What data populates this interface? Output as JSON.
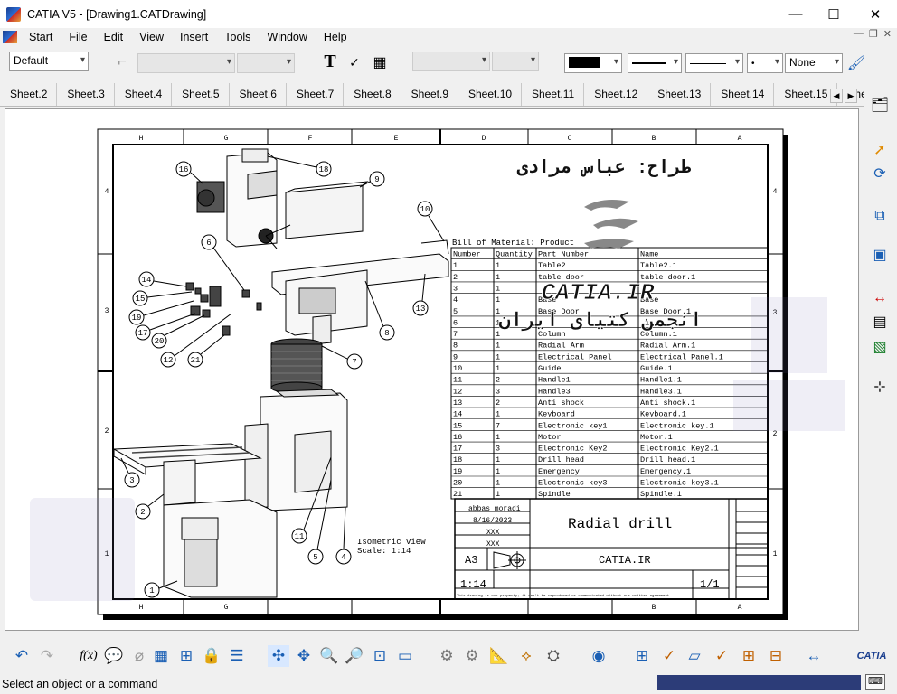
{
  "window": {
    "title": "CATIA V5 - [Drawing1.CATDrawing]",
    "min_glyph": "—",
    "max_glyph": "☐",
    "close_glyph": "✕"
  },
  "menu": [
    "Start",
    "File",
    "Edit",
    "View",
    "Insert",
    "Tools",
    "Window",
    "Help"
  ],
  "toolbar": {
    "style_value": "Default",
    "line_type": "None"
  },
  "tabs": [
    "Sheet.2",
    "Sheet.3",
    "Sheet.4",
    "Sheet.5",
    "Sheet.6",
    "Sheet.7",
    "Sheet.8",
    "Sheet.9",
    "Sheet.10",
    "Sheet.11",
    "Sheet.12",
    "Sheet.13",
    "Sheet.14",
    "Sheet.15",
    "Shee"
  ],
  "drawing": {
    "bom_title": "Bill of Material: Product",
    "bom_headers": [
      "Number",
      "Quantity",
      "Part Number",
      "Name"
    ],
    "bom_rows": [
      [
        "1",
        "1",
        "Table2",
        "Table2.1"
      ],
      [
        "2",
        "1",
        "table door",
        "table door.1"
      ],
      [
        "3",
        "1",
        "",
        ""
      ],
      [
        "4",
        "1",
        "Base",
        "Base"
      ],
      [
        "5",
        "1",
        "Base Door",
        "Base Door.1"
      ],
      [
        "6",
        "1",
        "",
        ".1"
      ],
      [
        "7",
        "1",
        "Column",
        "Column.1"
      ],
      [
        "8",
        "1",
        "Radial Arm",
        "Radial Arm.1"
      ],
      [
        "9",
        "1",
        "Electrical Panel",
        "Electrical Panel.1"
      ],
      [
        "10",
        "1",
        "Guide",
        "Guide.1"
      ],
      [
        "11",
        "2",
        "Handle1",
        "Handle1.1"
      ],
      [
        "12",
        "3",
        "Handle3",
        "Handle3.1"
      ],
      [
        "13",
        "2",
        "Anti shock",
        "Anti shock.1"
      ],
      [
        "14",
        "1",
        "Keyboard",
        "Keyboard.1"
      ],
      [
        "15",
        "7",
        "Electronic key1",
        "Electronic key.1"
      ],
      [
        "16",
        "1",
        "Motor",
        "Motor.1"
      ],
      [
        "17",
        "3",
        "Electronic Key2",
        "Electronic Key2.1"
      ],
      [
        "18",
        "1",
        "Drill head",
        "Drill head.1"
      ],
      [
        "19",
        "1",
        "Emergency",
        "Emergency.1"
      ],
      [
        "20",
        "1",
        "Electronic key3",
        "Electronic key3.1"
      ],
      [
        "21",
        "1",
        "Spindle",
        "Spindle.1"
      ]
    ],
    "title_block": {
      "designer": "abbas moradi",
      "date": "8/16/2023",
      "checked": "XXX",
      "approved": "XXX",
      "title": "Radial drill",
      "size": "A3",
      "company": "CATIA.IR",
      "scale": "1:14",
      "sheet": "1/1",
      "disclaimer": "This drawing is our property; it can't be reproduced or communicated without our written agreement."
    },
    "view_label": "Isometric view",
    "view_scale": "Scale:  1:14",
    "watermark_persian_top": "طراح: عباس مرادی",
    "watermark_logo": "CATIA.IR",
    "watermark_persian_bottom": "انجمن کتیای ایران",
    "border_cols_top": [
      "H",
      "G",
      "F",
      "E",
      "D",
      "C",
      "B",
      "A"
    ],
    "border_cols_bottom": [
      "H",
      "G",
      "B",
      "A"
    ],
    "border_rows_left": [
      "4",
      "3",
      "2",
      "1"
    ],
    "border_rows_right": [
      "4",
      "3",
      "2",
      "1"
    ],
    "balloons": [
      "1",
      "2",
      "3",
      "4",
      "5",
      "6",
      "7",
      "8",
      "9",
      "10",
      "11",
      "12",
      "13",
      "14",
      "15",
      "16",
      "17",
      "18",
      "19",
      "20",
      "21"
    ]
  },
  "status": {
    "message": "Select an object or a command"
  }
}
